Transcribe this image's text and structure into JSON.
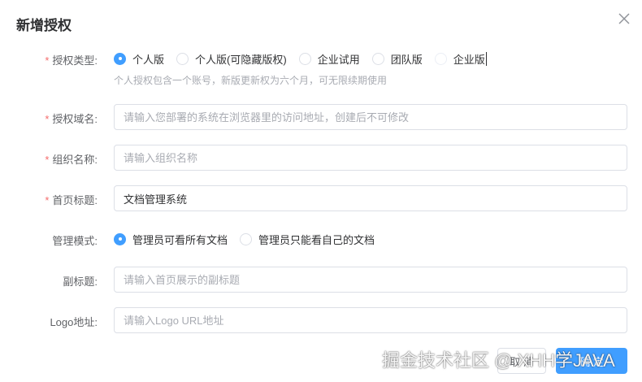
{
  "dialog": {
    "title": "新增授权",
    "close_icon": "close-icon"
  },
  "form": {
    "license_type": {
      "label": "授权类型:",
      "required": true,
      "options": [
        {
          "label": "个人版",
          "checked": true
        },
        {
          "label": "个人版(可隐藏版权)",
          "checked": false
        },
        {
          "label": "企业试用",
          "checked": false
        },
        {
          "label": "团队版",
          "checked": false
        },
        {
          "label": "企业版",
          "checked": false
        }
      ],
      "hint": "个人授权包含一个账号，新版更新权为六个月，可无限续期使用"
    },
    "domain": {
      "label": "授权域名:",
      "required": true,
      "value": "",
      "placeholder": "请输入您部署的系统在浏览器里的访问地址，创建后不可修改"
    },
    "org_name": {
      "label": "组织名称:",
      "required": true,
      "value": "",
      "placeholder": "请输入组织名称"
    },
    "home_title": {
      "label": "首页标题:",
      "required": true,
      "value": "文档管理系统",
      "placeholder": ""
    },
    "manage_mode": {
      "label": "管理模式:",
      "required": false,
      "options": [
        {
          "label": "管理员可看所有文档",
          "checked": true
        },
        {
          "label": "管理员只能看自己的文档",
          "checked": false
        }
      ]
    },
    "subtitle": {
      "label": "副标题:",
      "required": false,
      "value": "",
      "placeholder": "请输入首页展示的副标题"
    },
    "logo": {
      "label": "Logo地址:",
      "required": false,
      "value": "",
      "placeholder": "请输入Logo URL地址"
    }
  },
  "footer": {
    "cancel_label": "取 消",
    "confirm_label": "确 定"
  },
  "watermark": "掘金技术社区 @ XHH学JAVA",
  "colors": {
    "primary": "#409eff",
    "required": "#f56c6c",
    "border": "#dcdfe6",
    "placeholder": "#a8abb2"
  }
}
